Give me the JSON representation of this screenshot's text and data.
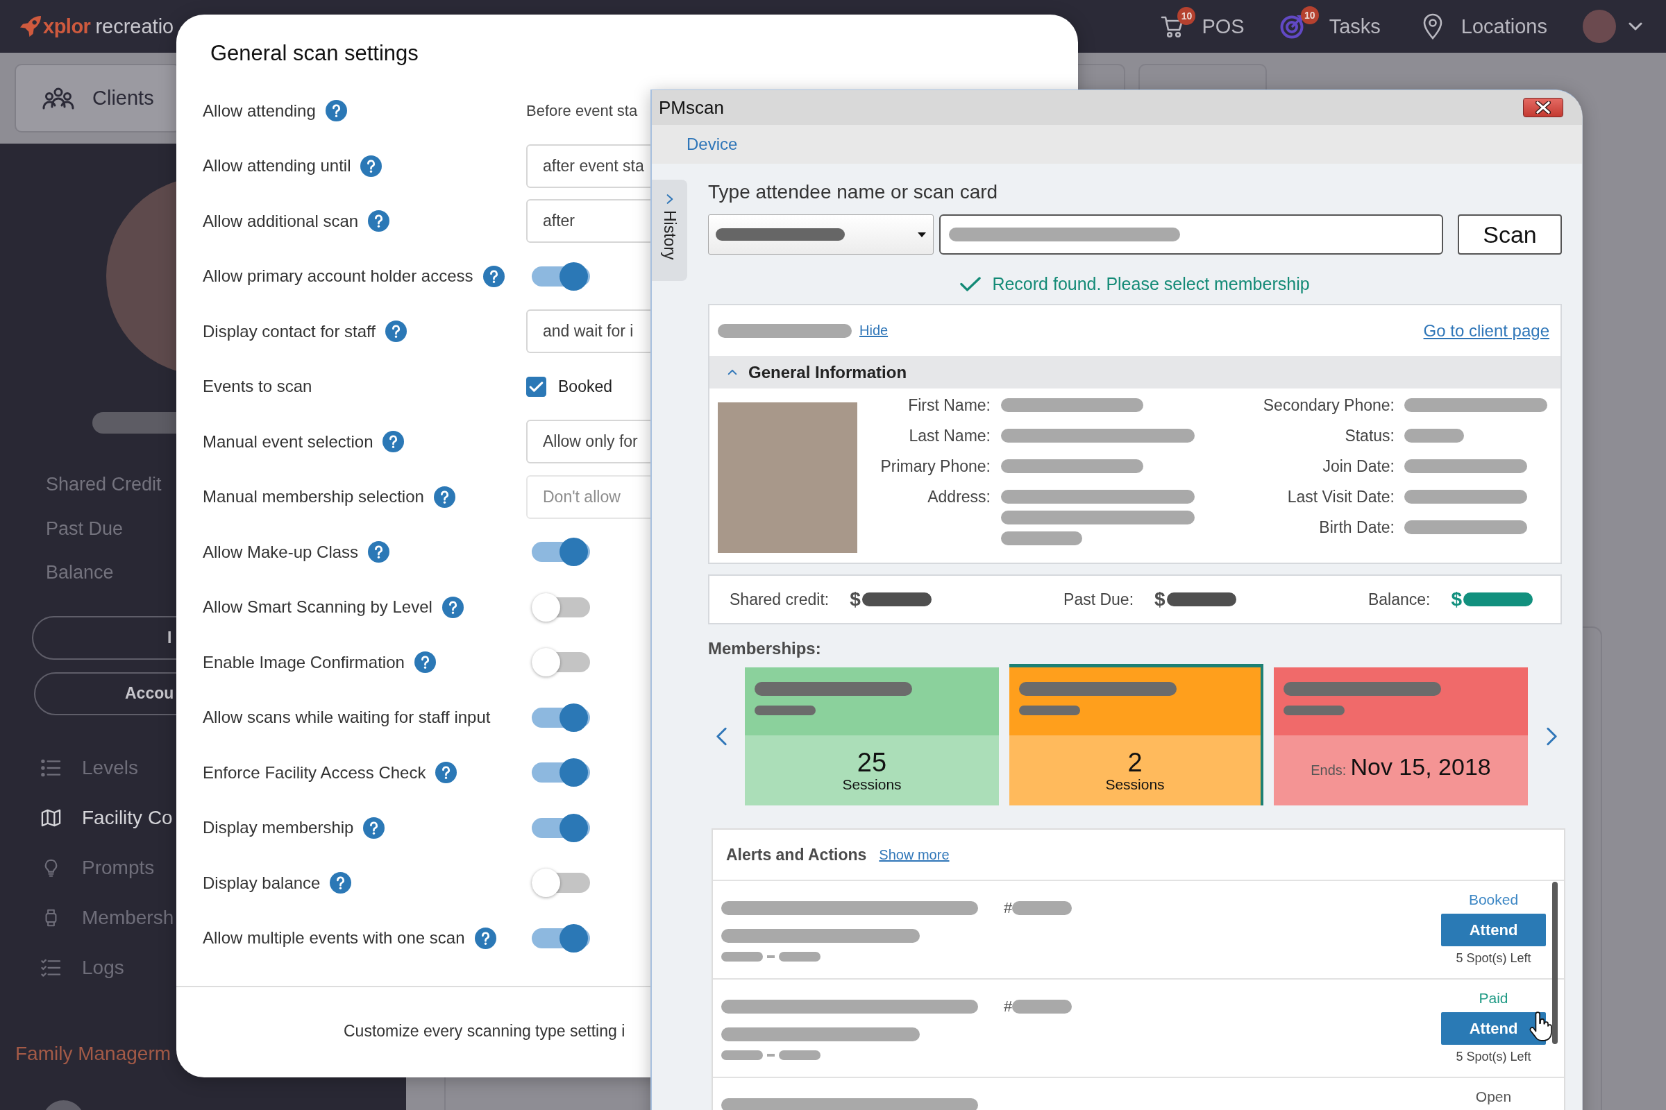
{
  "app_header": {
    "logo": {
      "brand": "xplor",
      "product": "recreatio"
    },
    "nav": [
      {
        "label": "POS",
        "badge": "10"
      },
      {
        "label": "Tasks",
        "badge": "10"
      },
      {
        "label": "Locations"
      }
    ]
  },
  "client_tab": {
    "label": "Clients"
  },
  "client_sidebar": {
    "summary": [
      "Shared Credit",
      "Past Due",
      "Balance"
    ],
    "buttons": [
      "I",
      "Accou"
    ],
    "menu": [
      {
        "label": "Levels",
        "selected": false
      },
      {
        "label": "Facility Co",
        "selected": true
      },
      {
        "label": "Prompts",
        "selected": false
      },
      {
        "label": "Membersh",
        "selected": false
      },
      {
        "label": "Logs",
        "selected": false
      }
    ],
    "section_title": "Family Managerm"
  },
  "scan_settings": {
    "title": "General scan settings",
    "settings": [
      {
        "label": "Allow attending",
        "help": true,
        "kind": "text",
        "value": "Before event sta"
      },
      {
        "label": "Allow attending until",
        "help": true,
        "kind": "select",
        "value": "after event sta",
        "disabled": false
      },
      {
        "label": "Allow additional scan",
        "help": true,
        "kind": "select",
        "value": "after",
        "disabled": false
      },
      {
        "label": "Allow primary account holder access",
        "help": true,
        "kind": "toggle",
        "on": true
      },
      {
        "label": "Display contact for staff",
        "help": true,
        "kind": "select",
        "value": "and wait for i",
        "disabled": false
      },
      {
        "label": "Events to scan",
        "help": false,
        "kind": "checkbox",
        "value": "Booked",
        "checked": true
      },
      {
        "label": "Manual event selection",
        "help": true,
        "kind": "select",
        "value": "Allow only for",
        "disabled": false
      },
      {
        "label": "Manual membership selection",
        "help": true,
        "kind": "select",
        "value": "Don't allow",
        "disabled": true
      },
      {
        "label": "Allow Make-up Class",
        "help": true,
        "kind": "toggle",
        "on": true
      },
      {
        "label": "Allow Smart Scanning by Level",
        "help": true,
        "kind": "toggle",
        "on": false
      },
      {
        "label": "Enable Image Confirmation",
        "help": true,
        "kind": "toggle",
        "on": false
      },
      {
        "label": "Allow scans while waiting for staff input",
        "help": false,
        "kind": "toggle",
        "on": true
      },
      {
        "label": "Enforce Facility Access Check",
        "help": true,
        "kind": "toggle",
        "on": true
      },
      {
        "label": "Display membership",
        "help": true,
        "kind": "toggle",
        "on": true
      },
      {
        "label": "Display balance",
        "help": true,
        "kind": "toggle",
        "on": false
      },
      {
        "label": "Allow multiple events with one scan",
        "help": true,
        "kind": "toggle",
        "on": true
      }
    ],
    "footer": "Customize every scanning type setting i"
  },
  "pmscan": {
    "title": "PMscan",
    "menu": [
      "Device"
    ],
    "history_tab": {
      "label": "History",
      "expanded": false
    },
    "search": {
      "label": "Type attendee name or scan card",
      "button": "Scan"
    },
    "status": "Record found. Please select membership",
    "client": {
      "hide_link": "Hide",
      "client_page_link": "Go to client page",
      "section": {
        "title": "General Information",
        "expanded": true
      },
      "fields_left": [
        "First Name:",
        "Last Name:",
        "Primary Phone:",
        "Address:"
      ],
      "fields_right": [
        "Secondary Phone:",
        "Status:",
        "Join Date:",
        "Last Visit Date:",
        "Birth Date:"
      ]
    },
    "balances": [
      {
        "label": "Shared credit:",
        "currency": "$",
        "color": "#4f4f4f"
      },
      {
        "label": "Past Due:",
        "currency": "$",
        "color": "#4f4f4f"
      },
      {
        "label": "Balance:",
        "currency": "$",
        "color": "#12907e"
      }
    ],
    "memberships": {
      "label": "Memberships:",
      "cards": [
        {
          "kind": "sessions",
          "count": "25",
          "unit": "Sessions",
          "color": "#8bd19c",
          "selected": false
        },
        {
          "kind": "sessions",
          "count": "2",
          "unit": "Sessions",
          "color": "#ff9f1c",
          "selected": true
        },
        {
          "kind": "ends",
          "prefix": "Ends:",
          "date": "Nov 15, 2018",
          "color": "#f06a6a",
          "selected": false
        }
      ]
    },
    "alerts": {
      "title": "Alerts and Actions",
      "more_link": "Show more",
      "rows": [
        {
          "status": "Booked",
          "color": "#3b86c4",
          "number_prefix": "#",
          "button": "Attend",
          "spots": "5 Spot(s) Left"
        },
        {
          "status": "Paid",
          "color": "#1f9a85",
          "number_prefix": "#",
          "button": "Attend",
          "spots": "5 Spot(s) Left"
        },
        {
          "status": "Open",
          "color": "#555555"
        }
      ]
    }
  }
}
